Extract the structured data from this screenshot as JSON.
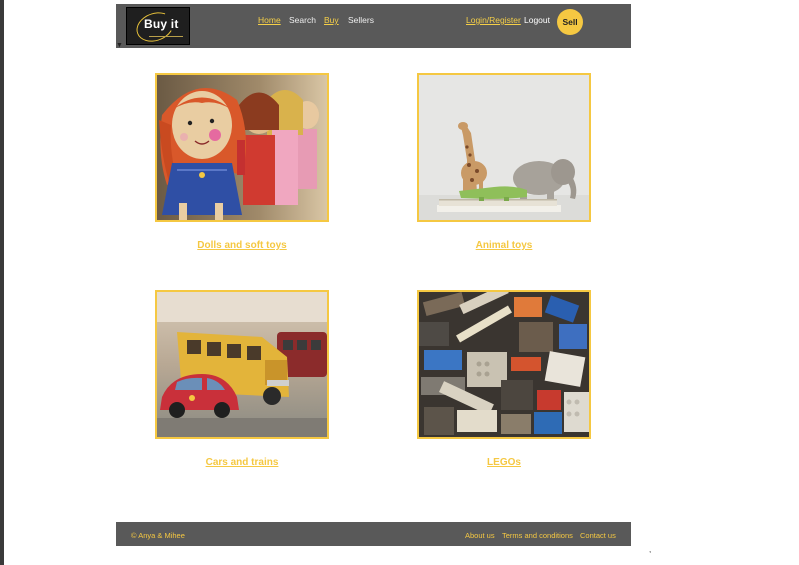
{
  "header": {
    "logo_text": "Buy it",
    "nav": {
      "home": "Home",
      "search": "Search",
      "buy": "Buy",
      "sellers": "Sellers"
    },
    "login_register": "Login/Register",
    "logout": "Logout",
    "sell": "Sell"
  },
  "categories": [
    {
      "label": "Dolls and soft toys",
      "image": "dolls-photo"
    },
    {
      "label": "Animal toys",
      "image": "animal-toys-photo"
    },
    {
      "label": "Cars and trains",
      "image": "cars-photo"
    },
    {
      "label": "LEGOs",
      "image": "legos-photo"
    }
  ],
  "footer": {
    "copyright": "© Anya & Mihee",
    "about": "About us",
    "terms": "Terms and conditions",
    "contact": "Contact us"
  },
  "colors": {
    "accent": "#f5c842",
    "header_bg": "#595959",
    "page_bg": "#ffffff"
  }
}
